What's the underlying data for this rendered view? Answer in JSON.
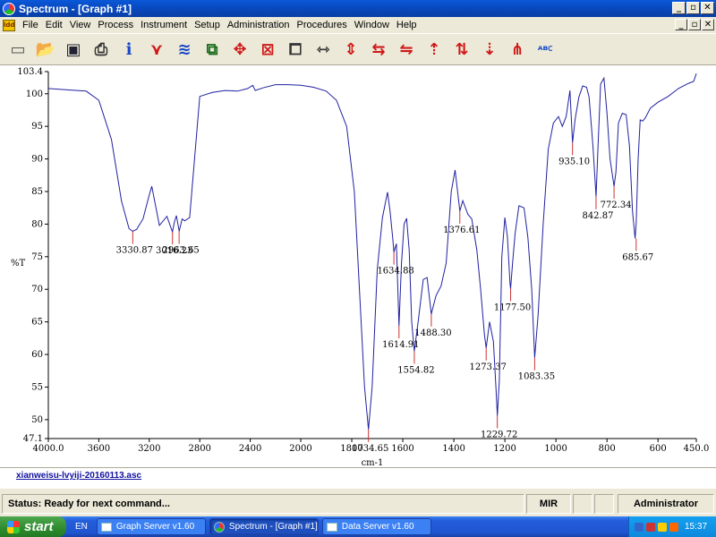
{
  "window": {
    "title": "Spectrum - [Graph #1]",
    "controls": [
      "_",
      "▫",
      "✕"
    ],
    "mdi_controls": [
      "_",
      "▫",
      "✕"
    ]
  },
  "menu": {
    "icon_text": "ldd",
    "items": [
      "File",
      "Edit",
      "View",
      "Process",
      "Instrument",
      "Setup",
      "Administration",
      "Procedures",
      "Window",
      "Help"
    ]
  },
  "toolbar": {
    "tools": [
      {
        "name": "new-icon",
        "glyph": "▭",
        "color": "#555"
      },
      {
        "name": "open-folder-icon",
        "glyph": "📂",
        "color": "#c90"
      },
      {
        "name": "save-icon",
        "glyph": "▣",
        "color": "#223"
      },
      {
        "name": "print-icon",
        "glyph": "⎙",
        "color": "#333"
      },
      {
        "name": "info-icon",
        "glyph": "ℹ",
        "color": "#1848c8"
      },
      {
        "name": "delete-spectrum-icon",
        "glyph": "⋎",
        "color": "#d01818"
      },
      {
        "name": "compare-spectrum-icon",
        "glyph": "≋",
        "color": "#1848c8"
      },
      {
        "name": "select-region-icon",
        "glyph": "⧉",
        "color": "#1a6a1a"
      },
      {
        "name": "move-icon",
        "glyph": "✥",
        "color": "#d01818"
      },
      {
        "name": "clear-label-icon",
        "glyph": "⊠",
        "color": "#d01818"
      },
      {
        "name": "copy-graph-icon",
        "glyph": "⧠",
        "color": "#333"
      },
      {
        "name": "zoom-horizontal-icon",
        "glyph": "⇿",
        "color": "#333"
      },
      {
        "name": "expand-vertical-icon",
        "glyph": "⇕",
        "color": "#d01818"
      },
      {
        "name": "expand-horizontal-icon",
        "glyph": "⇆",
        "color": "#d01818"
      },
      {
        "name": "shrink-horizontal-icon",
        "glyph": "⇋",
        "color": "#d01818"
      },
      {
        "name": "scale-up-icon",
        "glyph": "⇡",
        "color": "#d01818"
      },
      {
        "name": "scale-both-icon",
        "glyph": "⇅",
        "color": "#d01818"
      },
      {
        "name": "scale-down-icon",
        "glyph": "⇣",
        "color": "#d01818"
      },
      {
        "name": "peak-pick-icon",
        "glyph": "⋔",
        "color": "#d01818"
      },
      {
        "name": "label-peaks-icon",
        "glyph": "ᴬᴮꟲ",
        "color": "#1848c8"
      }
    ]
  },
  "chart_data": {
    "type": "line",
    "xlabel": "cm-1",
    "ylabel": "%T",
    "xlim": [
      4000.0,
      450.0
    ],
    "ylim": [
      47.1,
      103.4
    ],
    "x_ticks": [
      "4000.0",
      "3600",
      "3200",
      "2800",
      "2400",
      "2000",
      "1800",
      "1600",
      "1400",
      "1200",
      "1000",
      "800",
      "600",
      "450.0"
    ],
    "y_ticks": [
      "103.4",
      "100",
      "95",
      "90",
      "85",
      "80",
      "75",
      "70",
      "65",
      "60",
      "55",
      "50",
      "47.1"
    ],
    "line_color": "#2020a0",
    "peak_color": "#cc3333",
    "series": [
      {
        "x": [
          4000,
          3850,
          3700,
          3600,
          3500,
          3420,
          3360,
          3331,
          3300,
          3250,
          3200,
          3180,
          3120,
          3060,
          3030,
          3016,
          3000,
          2985,
          2963,
          2940,
          2920,
          2880,
          2800,
          2700,
          2600,
          2500,
          2420,
          2380,
          2360,
          2300,
          2200,
          2100,
          2000,
          1950,
          1900,
          1860,
          1820,
          1790,
          1770,
          1750,
          1734.65,
          1720,
          1700,
          1680,
          1660,
          1650,
          1640,
          1634.88,
          1625,
          1614.91,
          1605,
          1595,
          1585,
          1575,
          1565,
          1554.82,
          1540,
          1520,
          1505,
          1488.3,
          1470,
          1450,
          1430,
          1410,
          1395,
          1376.61,
          1365,
          1345,
          1330,
          1310,
          1295,
          1280,
          1273.37,
          1260,
          1245,
          1235,
          1229.72,
          1222,
          1212,
          1200,
          1190,
          1180,
          1177.5,
          1170,
          1160,
          1145,
          1125,
          1110,
          1095,
          1083.35,
          1070,
          1050,
          1030,
          1010,
          990,
          975,
          960,
          945,
          935.1,
          925,
          910,
          895,
          880,
          870,
          855,
          842.87,
          835,
          825,
          812,
          800,
          788,
          772.34,
          765,
          755,
          740,
          725,
          712,
          700,
          690,
          685.67,
          678,
          670,
          660,
          650,
          630,
          600,
          560,
          520,
          480,
          460,
          450
        ],
        "y": [
          100.8,
          100.6,
          100.4,
          99.0,
          93.0,
          83.5,
          79.3,
          78.9,
          79.2,
          80.8,
          84.5,
          85.8,
          79.8,
          81.2,
          79.5,
          78.8,
          80.4,
          81.3,
          78.9,
          80.8,
          80.5,
          81.0,
          99.6,
          100.2,
          100.5,
          100.4,
          100.8,
          101.3,
          100.5,
          100.9,
          101.4,
          101.4,
          101.3,
          101.0,
          100.4,
          99.0,
          95.0,
          85.0,
          70.0,
          55.0,
          48.5,
          55.0,
          73.0,
          81.0,
          84.9,
          82.0,
          78.0,
          75.7,
          77.0,
          64.4,
          74.0,
          80.0,
          80.9,
          76.0,
          65.0,
          60.5,
          65.0,
          71.5,
          71.8,
          66.2,
          69.0,
          70.5,
          74.0,
          85.0,
          88.3,
          82.0,
          83.6,
          81.5,
          80.8,
          76.0,
          70.0,
          63.0,
          61.0,
          65.0,
          62.0,
          55.0,
          50.6,
          56.0,
          75.0,
          81.0,
          78.0,
          71.0,
          70.1,
          74.0,
          78.5,
          82.8,
          82.5,
          78.0,
          70.0,
          59.5,
          66.0,
          80.0,
          91.5,
          95.5,
          96.5,
          95.0,
          96.5,
          100.5,
          92.5,
          96.0,
          99.5,
          101.2,
          101.0,
          99.5,
          92.0,
          84.2,
          92.0,
          101.5,
          102.4,
          97.0,
          90.0,
          85.8,
          88.0,
          95.5,
          97.0,
          96.8,
          92.0,
          82.0,
          77.8,
          80.0,
          90.0,
          96.0,
          95.8,
          96.3,
          97.8,
          98.7,
          99.6,
          100.8,
          101.6,
          101.9,
          103.1
        ]
      }
    ],
    "peaks": [
      {
        "x": 3330.87,
        "y": 78.9,
        "label": "3330.87"
      },
      {
        "x": 3016.23,
        "y": 78.8,
        "label": "3016.23"
      },
      {
        "x": 2963.65,
        "y": 78.9,
        "label": "2963.65"
      },
      {
        "x": 1734.65,
        "y": 48.5,
        "label": "1734.65"
      },
      {
        "x": 1634.88,
        "y": 75.7,
        "label": "1634.88"
      },
      {
        "x": 1614.91,
        "y": 64.4,
        "label": "1614.91"
      },
      {
        "x": 1554.82,
        "y": 60.5,
        "label": "1554.82"
      },
      {
        "x": 1488.3,
        "y": 66.2,
        "label": "1488.30"
      },
      {
        "x": 1376.61,
        "y": 82.0,
        "label": "1376.61"
      },
      {
        "x": 1273.37,
        "y": 61.0,
        "label": "1273.37"
      },
      {
        "x": 1229.72,
        "y": 50.6,
        "label": "1229.72"
      },
      {
        "x": 1177.5,
        "y": 70.1,
        "label": "1177.50"
      },
      {
        "x": 1083.35,
        "y": 59.5,
        "label": "1083.35"
      },
      {
        "x": 935.1,
        "y": 92.5,
        "label": "935.10"
      },
      {
        "x": 842.87,
        "y": 84.2,
        "label": "842.87"
      },
      {
        "x": 772.34,
        "y": 85.8,
        "label": "772.34"
      },
      {
        "x": 685.67,
        "y": 77.8,
        "label": "685.67"
      }
    ]
  },
  "file_link": "xianweisu-lvyiji-20160113.asc",
  "status": {
    "message": "Status: Ready for next command...",
    "mode": "MIR",
    "user": "Administrator"
  },
  "taskbar": {
    "start_label": "start",
    "lang": "EN",
    "tasks": [
      {
        "label": "Graph Server v1.60",
        "active": false
      },
      {
        "label": "Spectrum - [Graph #1]",
        "active": true
      },
      {
        "label": "Data Server v1.60",
        "active": false
      }
    ],
    "clock": "15:37"
  }
}
